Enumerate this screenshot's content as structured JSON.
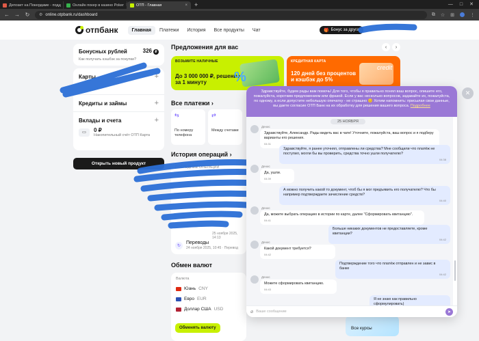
{
  "browser": {
    "tabs": [
      {
        "title": "Депозит на Покердаме - подд",
        "color": "#e05a47",
        "active": false
      },
      {
        "title": "Онлайн покер в казино Poker",
        "color": "#37b24d",
        "active": false
      },
      {
        "title": "ОТП - Главная",
        "color": "#c8f000",
        "active": true
      }
    ],
    "new_tab": "+",
    "url": "online.otpbank.ru/dashboard"
  },
  "header": {
    "logo": "отпбанк",
    "nav": [
      "Главная",
      "Платежи",
      "История",
      "Все продукты",
      "Чат"
    ],
    "bonus_button": "Бонус за друга"
  },
  "left": {
    "bonus_title": "Бонусных рублей",
    "bonus_value": "326",
    "bonus_link": "Как получать кэшбэк за покупки?",
    "cards": "Карты",
    "credits": "Кредиты и займы",
    "deposits": "Вклады и счета",
    "account_amount": "0 ₽",
    "account_desc": "Накопительный счёт ОТП Карта",
    "open_product": "Открыть новый продукт"
  },
  "main": {
    "offers_title": "Предложения для вас",
    "promo1": {
      "tag": "ВОЗЬМИТЕ НАЛИЧНЫЕ",
      "title": "До 3 000 000 ₽, решение за 1 минуту"
    },
    "promo2": {
      "tag": "КРЕДИТНАЯ КАРТА",
      "title": "120 дней без процентов и кэшбэк до 5%",
      "art": "credit"
    },
    "payments_title": "Все платежи",
    "payments": [
      "По номеру телефона",
      "Между счетами"
    ],
    "history_title": "История операций",
    "history_label": "ПОСЛЕДНИЕ ОПЕРАЦИИ",
    "history_time1": "25 ноября 2025, 14:13",
    "history_item": {
      "title": "Переводы",
      "sub": "24 ноября 2025, 10:45",
      "tail": "Перевод"
    },
    "fx_title": "Обмен валют",
    "fx_label": "Валюта",
    "fx_rows": [
      {
        "name": "Юань",
        "code": "CNY",
        "flag": "#de2910"
      },
      {
        "name": "Евро",
        "code": "EUR",
        "flag": "#2b4fb4"
      },
      {
        "name": "Доллар США",
        "code": "USD",
        "flag": "#b22234"
      }
    ],
    "fx_button": "Обменять валюту",
    "kurs": "Все курсы"
  },
  "chat": {
    "banner": "Здравствуйте, будем рады вам помочь! Для того, чтобы я правильно понял ваш вопрос, опишите его, пожалуйста, коротким предложением или фразой. Если у вас несколько вопросов, задавайте их, пожалуйста, по одному, а если допустите небольшую опечатку - не страшно 😊 Хотим напомнить: присылая свои данные, вы даете согласие ОТП Банк на их обработку для решения вашего вопроса.",
    "banner_more": "Подробнее",
    "date": "25 НОЯБРЯ",
    "agent": "Денис",
    "messages": [
      {
        "dir": "in",
        "text": "Здравствуйте, Александр. Рады видеть вас в чате! Уточните, пожалуйста, ваш вопрос и я подберу варианты его решения.",
        "time": "04:31"
      },
      {
        "dir": "out",
        "text": "Здравствуйте, я ранее уточнял, отправлены ли средства? Мне сообщили что платёж не поступил, могли бы вы проверить, средства точно ушли получателю?",
        "time": "04:38"
      },
      {
        "dir": "in",
        "text": "Да, ушли.",
        "time": "04:39"
      },
      {
        "dir": "out",
        "text": "А можно получить какой то документ, чтоб бы я мог предъявить его получателю? Что бы например подтверждаете зачисление средств?",
        "time": "04:40"
      },
      {
        "dir": "in",
        "text": "Да, можете выбрать операцию в истории по карте, далее \"Сформировать квитанцию\".",
        "time": "04:41"
      },
      {
        "dir": "out",
        "text": "Больше никаких документов не предоставляете, кроме квитанции?",
        "time": "04:42"
      },
      {
        "dir": "in",
        "text": "Какой документ требуется?",
        "time": "04:42"
      },
      {
        "dir": "out",
        "text": "Подтверждение того что платёж отправлен и не завис в банке",
        "time": "04:42"
      },
      {
        "dir": "in",
        "text": "Можете сформировать квитанцию.",
        "time": "04:43"
      },
      {
        "dir": "out",
        "text": "Я не знаю как правильно сформулировать)",
        "time": ""
      }
    ],
    "input_placeholder": "Ваше сообщение"
  }
}
